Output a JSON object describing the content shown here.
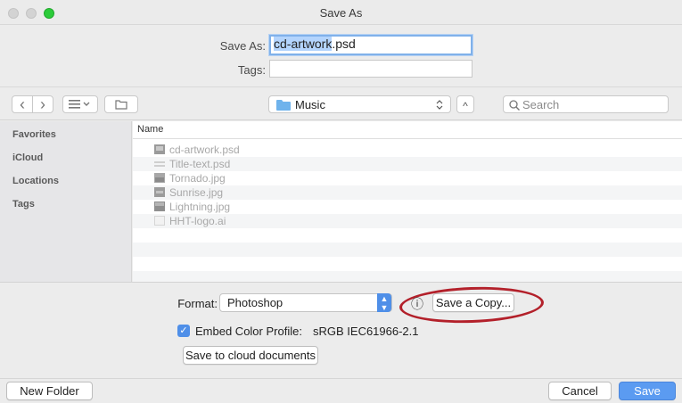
{
  "window": {
    "title": "Save As"
  },
  "form": {
    "save_as_label": "Save As:",
    "filename_selected": "cd-artwork",
    "filename_ext": ".psd",
    "tags_label": "Tags:",
    "tags_value": ""
  },
  "toolbar": {
    "back_glyph": "‹",
    "forward_glyph": "›",
    "location": "Music",
    "search_placeholder": "Search",
    "collapse_glyph": "^"
  },
  "sidebar": {
    "items": [
      {
        "label": "Favorites"
      },
      {
        "label": "iCloud"
      },
      {
        "label": "Locations"
      },
      {
        "label": "Tags"
      }
    ]
  },
  "file_list": {
    "column_header": "Name",
    "files": [
      {
        "name": "cd-artwork.psd",
        "icon": "image-file-icon"
      },
      {
        "name": "Title-text.psd",
        "icon": "text-file-icon"
      },
      {
        "name": "Tornado.jpg",
        "icon": "image-file-icon"
      },
      {
        "name": "Sunrise.jpg",
        "icon": "image-file-icon"
      },
      {
        "name": "Lightning.jpg",
        "icon": "image-file-icon"
      },
      {
        "name": "HHT-logo.ai",
        "icon": "blank-file-icon"
      }
    ]
  },
  "options": {
    "format_label": "Format:",
    "format_value": "Photoshop",
    "info_glyph": "ⓘ",
    "save_copy_label": "Save a Copy...",
    "embed_label": "Embed Color Profile:",
    "embed_value": "sRGB IEC61966-2.1",
    "embed_checked": true,
    "cloud_button": "Save to cloud documents"
  },
  "footer": {
    "new_folder": "New Folder",
    "cancel": "Cancel",
    "save": "Save"
  },
  "colors": {
    "accent": "#4f8fe8",
    "annotation": "#b3202a",
    "folder": "#6fb3ec"
  }
}
